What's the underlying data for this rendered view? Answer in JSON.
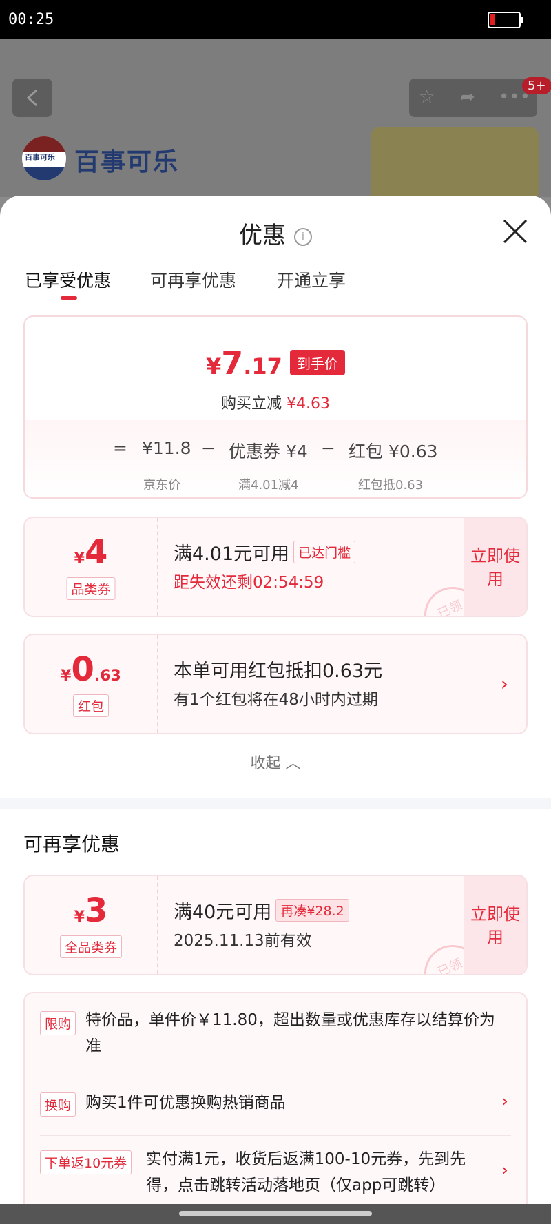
{
  "status_bar": {
    "time": "00:25"
  },
  "background": {
    "brand": "百事可乐",
    "logo_text": "百事可乐",
    "badge": "5+"
  },
  "sheet": {
    "title": "优惠",
    "info_glyph": "i"
  },
  "tabs": [
    {
      "label": "已享受优惠",
      "active": true
    },
    {
      "label": "可再享优惠",
      "active": false
    },
    {
      "label": "开通立享",
      "active": false
    }
  ],
  "summary": {
    "currency": "¥",
    "final_price_int": "7",
    "final_price_dec": ".17",
    "final_tag": "到手价",
    "reduce_label": "购买立减",
    "reduce_value": "¥4.63",
    "formula": {
      "eq": "=",
      "minus": "−",
      "base_value": "¥11.8",
      "base_label": "京东价",
      "coupon_value": "优惠券 ¥4",
      "coupon_label": "满4.01减4",
      "redpacket_value": "红包 ¥0.63",
      "redpacket_label": "红包抵0.63"
    }
  },
  "coupons_enjoyed": [
    {
      "currency": "¥",
      "amount": "4",
      "decimal": "",
      "label": "品类券",
      "title": "满4.01元可用",
      "tag": "已达门槛",
      "subtitle": "距失效还剩02:54:59",
      "action": "立即使用",
      "stamp": "已领"
    },
    {
      "currency": "¥",
      "amount": "0",
      "decimal": ".63",
      "label": "红包",
      "title": "本单可用红包抵扣0.63元",
      "subtitle": "有1个红包将在48小时内过期"
    }
  ],
  "collapse_label": "收起",
  "more_section": {
    "title": "可再享优惠",
    "coupon": {
      "currency": "¥",
      "amount": "3",
      "label": "全品类券",
      "title": "满40元可用",
      "tag": "再凑¥28.2",
      "subtitle": "2025.11.13前有效",
      "action": "立即使用",
      "stamp": "已领"
    }
  },
  "promotions": [
    {
      "tag": "限购",
      "text": "特价品，单件价￥11.80，超出数量或优惠库存以结算价为准"
    },
    {
      "tag": "换购",
      "text": "购买1件可优惠换购热销商品"
    },
    {
      "tag": "下单返10元券",
      "text": "实付满1元，收货后返满100-10元券，先到先得，点击跳转活动落地页（仅app可跳转）"
    }
  ],
  "colors": {
    "accent": "#e4293a",
    "coupon_bg": "#fff7f8"
  }
}
